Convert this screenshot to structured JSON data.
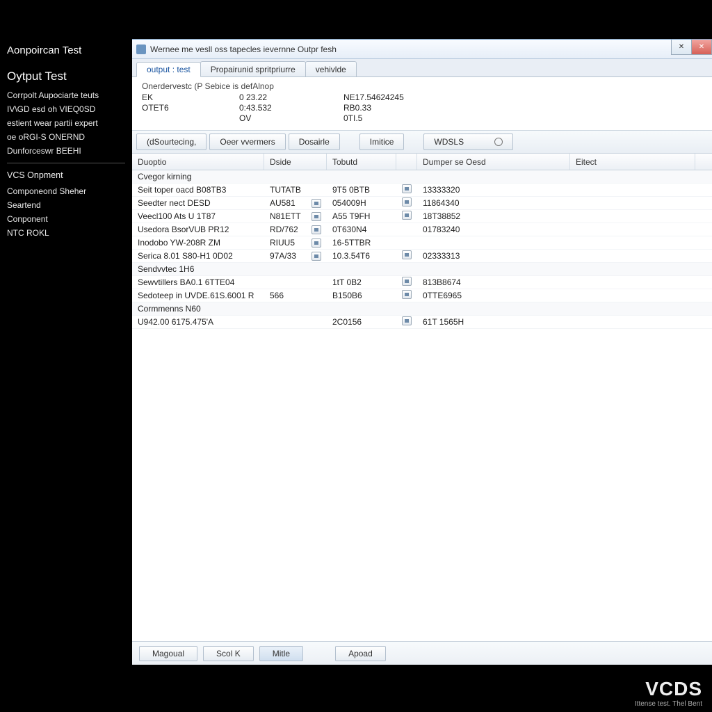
{
  "sidebar": {
    "header1": "Aonpoircan Test",
    "header2": "Oytput Test",
    "items1": [
      "Corrpolt Aupociarte teuts",
      "IV\\GD esd oh VIEQ0SD",
      "estient wear partii expert",
      "oe oRGI-S ONERND",
      "Dunforceswr BEEHI"
    ],
    "group2_title": "VCS Onpment",
    "items2": [
      "Componeond Sheher",
      "Seartend",
      "Conponent",
      "NTC ROKL"
    ]
  },
  "window": {
    "title": "Wernee me vesll oss tapecles ievernne Outpr fesh",
    "tabs": [
      "output : test",
      "Propairunid spritpriurre",
      "vehivlde"
    ],
    "active_tab": 0,
    "info": {
      "title": "Onerdervestc  (P  Sebice is defAlnop",
      "rows": [
        [
          "EK",
          "0 23.22",
          "NE17.54624245"
        ],
        [
          "OTET6",
          "0:43.532",
          "RB0.33"
        ],
        [
          "",
          "OV",
          "0TI.5"
        ]
      ]
    },
    "toolbar": [
      "(dSourtecing,",
      "Oeer vvermers",
      "Dosairle",
      "Imitice",
      "WDSLS"
    ],
    "columns": [
      "Duoptio",
      "Dside",
      "",
      "Tobutd",
      "",
      "Dumper se Oesd",
      "Eitect"
    ],
    "rows": [
      {
        "group": true,
        "c1": "Cvegor kirning"
      },
      {
        "c1": "Seit toper oacd B08TB3",
        "c2": "TUTATB",
        "c3": "9T5 0BTB",
        "i1": true,
        "c5": "13333320"
      },
      {
        "c1": "Seedter nect DESD",
        "c2": "AU581",
        "i0": true,
        "c3": "054009H",
        "i1": true,
        "c5": "11864340"
      },
      {
        "c1": "Veecl100 Ats U 1T87",
        "c2": "N81ETT",
        "i0": true,
        "c3": "A55 T9FH",
        "i1": true,
        "c5": "18T38852"
      },
      {
        "c1": "Usedora BsorVUB PR12",
        "c2": "RD/762",
        "i0": true,
        "c3": "0T630N4",
        "c5": "01783240"
      },
      {
        "c1": "Inodobo YW-208R ZM",
        "c2": "RIUU5",
        "i0": true,
        "c3": "16-5TTBR"
      },
      {
        "c1": "Serica 8.01 S80-H1 0D02",
        "c2": "97A/33",
        "i0": true,
        "c3": "10.3.54T6",
        "i1": true,
        "c5": "02333313"
      },
      {
        "group": true,
        "c1": "Sendvvtec 1H6"
      },
      {
        "c1": "Sewvtillers BA0.1 6TTE04",
        "c3": "1tT 0B2",
        "i1": true,
        "c5": "813B8674"
      },
      {
        "c1": "Sedoteep in UVDE.61S.6001 R",
        "c2": "566",
        "c3": "B150B6",
        "i1": true,
        "c5": "0TTE6965"
      },
      {
        "group": true,
        "c1": "Cormmenns N60"
      },
      {
        "c1": "U942.00 6175.475'A",
        "c3": "2C0156",
        "i1": true,
        "c5": "61T 1565H"
      }
    ],
    "footer": [
      "Magoual",
      "Scol  K",
      "Mitle",
      "Apoad"
    ]
  },
  "brand": {
    "logo": "VCDS",
    "tag": "Ittense test. Thel Bent"
  }
}
